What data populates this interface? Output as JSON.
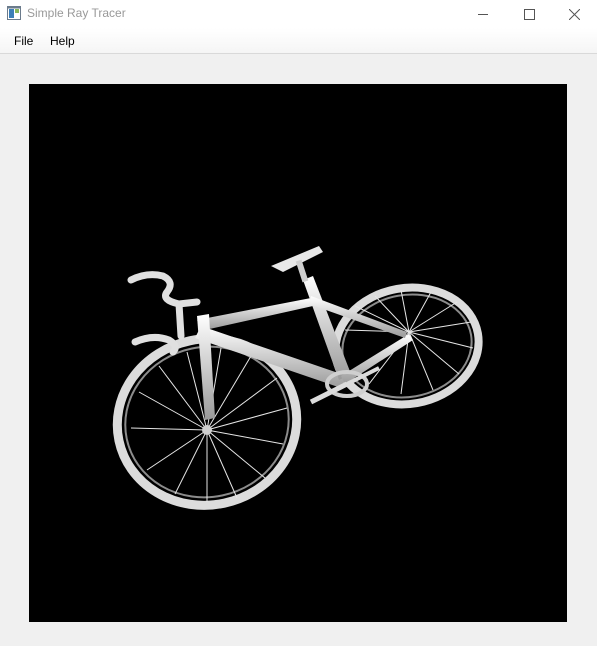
{
  "window": {
    "title": "Simple Ray Tracer",
    "app_icon": "app-window-icon",
    "controls": {
      "minimize_icon": "minimize-icon",
      "maximize_icon": "maximize-icon",
      "close_icon": "close-icon"
    }
  },
  "menu": {
    "items": [
      {
        "label": "File"
      },
      {
        "label": "Help"
      }
    ]
  },
  "render": {
    "subject": "bicycle",
    "background_color": "#000000",
    "object_color": "#e8e8e8"
  }
}
